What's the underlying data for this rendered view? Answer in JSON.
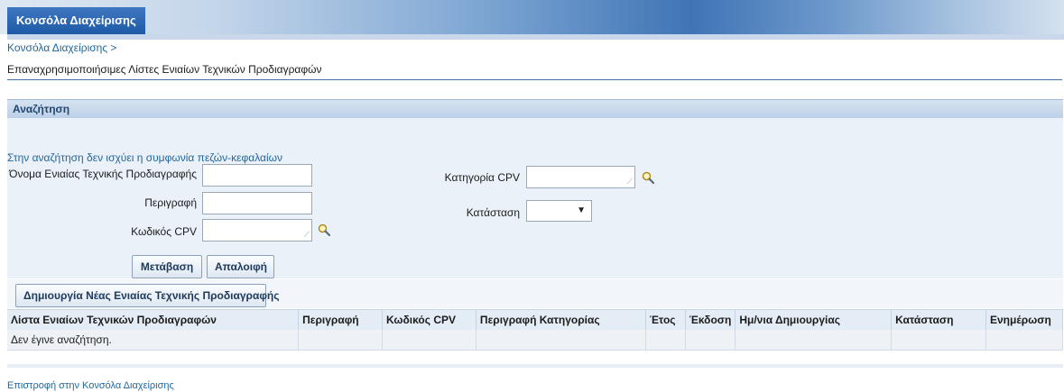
{
  "app": {
    "tab_label": "Κονσόλα Διαχείρισης"
  },
  "breadcrumb": "Κονσόλα Διαχείρισης >",
  "page_title": "Επαναχρησιμοποιήσιμες Λίστες Ενιαίων Τεχνικών Προδιαγραφών",
  "search": {
    "header": "Αναζήτηση",
    "case_hint": "Στην αναζήτηση δεν ισχύει η συμφωνία πεζών-κεφαλαίων",
    "fields": {
      "name_label": "Όνομα Ενιαίας Τεχνικής Προδιαγραφής",
      "name_value": "",
      "description_label": "Περιγραφή",
      "description_value": "",
      "cpv_code_label": "Κωδικός CPV",
      "cpv_code_value": "",
      "cpv_category_label": "Κατηγορία CPV",
      "cpv_category_value": "",
      "status_label": "Κατάσταση",
      "status_value": ""
    },
    "go_button": "Μετάβαση",
    "clear_button": "Απαλοιφή"
  },
  "create_button": "Δημιουργία Νέας Ενιαίας Τεχνικής Προδιαγραφής",
  "results": {
    "columns": [
      "Λίστα Ενιαίων Τεχνικών Προδιαγραφών",
      "Περιγραφή",
      "Κωδικός CPV",
      "Περιγραφή Κατηγορίας",
      "Έτος",
      "Έκδοση",
      "Ημ/νια Δημιουργίας",
      "Κατάσταση",
      "Ενημέρωση"
    ],
    "empty_message": "Δεν έγινε αναζήτηση."
  },
  "return_link": "Επιστροφή στην Κονσόλα Διαχείρισης",
  "colors": {
    "brand_blue": "#1e5aa6",
    "link": "#23679e",
    "panel_bg": "#eaf1f9"
  },
  "icons": {
    "lookup": "search-icon",
    "dropdown": "chevron-down-icon"
  }
}
